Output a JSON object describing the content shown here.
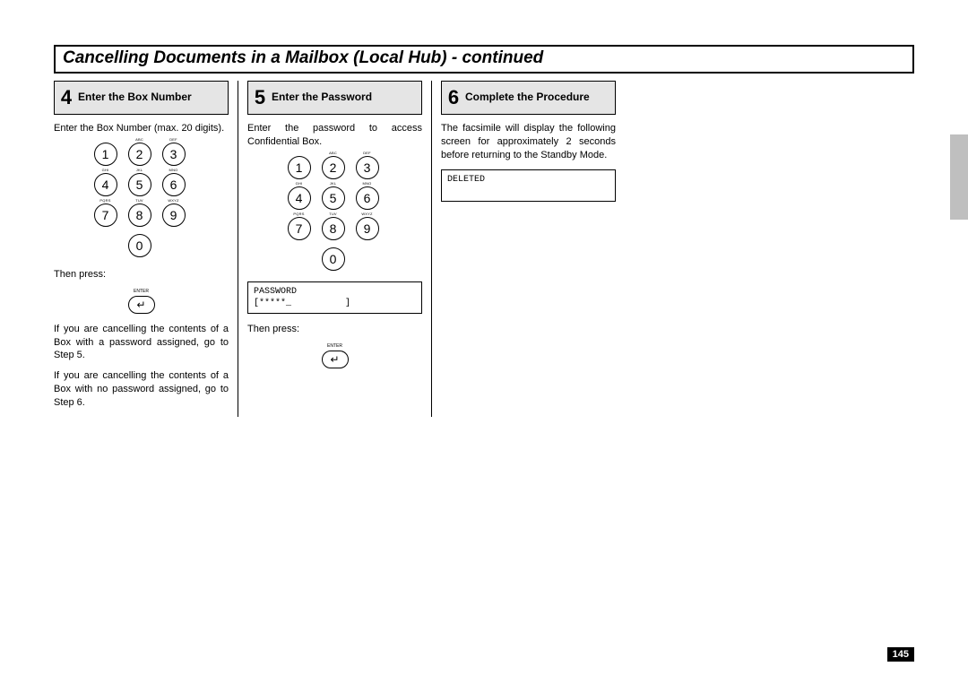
{
  "page_number": "145",
  "title": "Cancelling Documents in a Mailbox (Local Hub) - continued",
  "keypad_subs": [
    "",
    "ABC",
    "DEF",
    "GHI",
    "JKL",
    "MNO",
    "PQRS",
    "TUV",
    "WXYZ"
  ],
  "enter_label": "ENTER",
  "enter_glyph": "↵",
  "steps": [
    {
      "num": "4",
      "title": "Enter the Box Number",
      "intro": "Enter the Box Number (max. 20 digits).",
      "then_press": "Then press:",
      "note1": "If you are cancelling the contents of a Box with a password assigned, go to Step 5.",
      "note2": "If you are cancelling the contents of a Box with no password assigned, go to Step 6."
    },
    {
      "num": "5",
      "title": "Enter the Password",
      "intro": "Enter the password to access Confidential Box.",
      "lcd_line1": "PASSWORD",
      "lcd_line2": "[*****_          ]",
      "then_press": "Then press:"
    },
    {
      "num": "6",
      "title": "Complete the Procedure",
      "intro": "The facsimile will display the following screen for approximately 2 seconds before returning to the Standby Mode.",
      "lcd_line1": "DELETED"
    }
  ]
}
